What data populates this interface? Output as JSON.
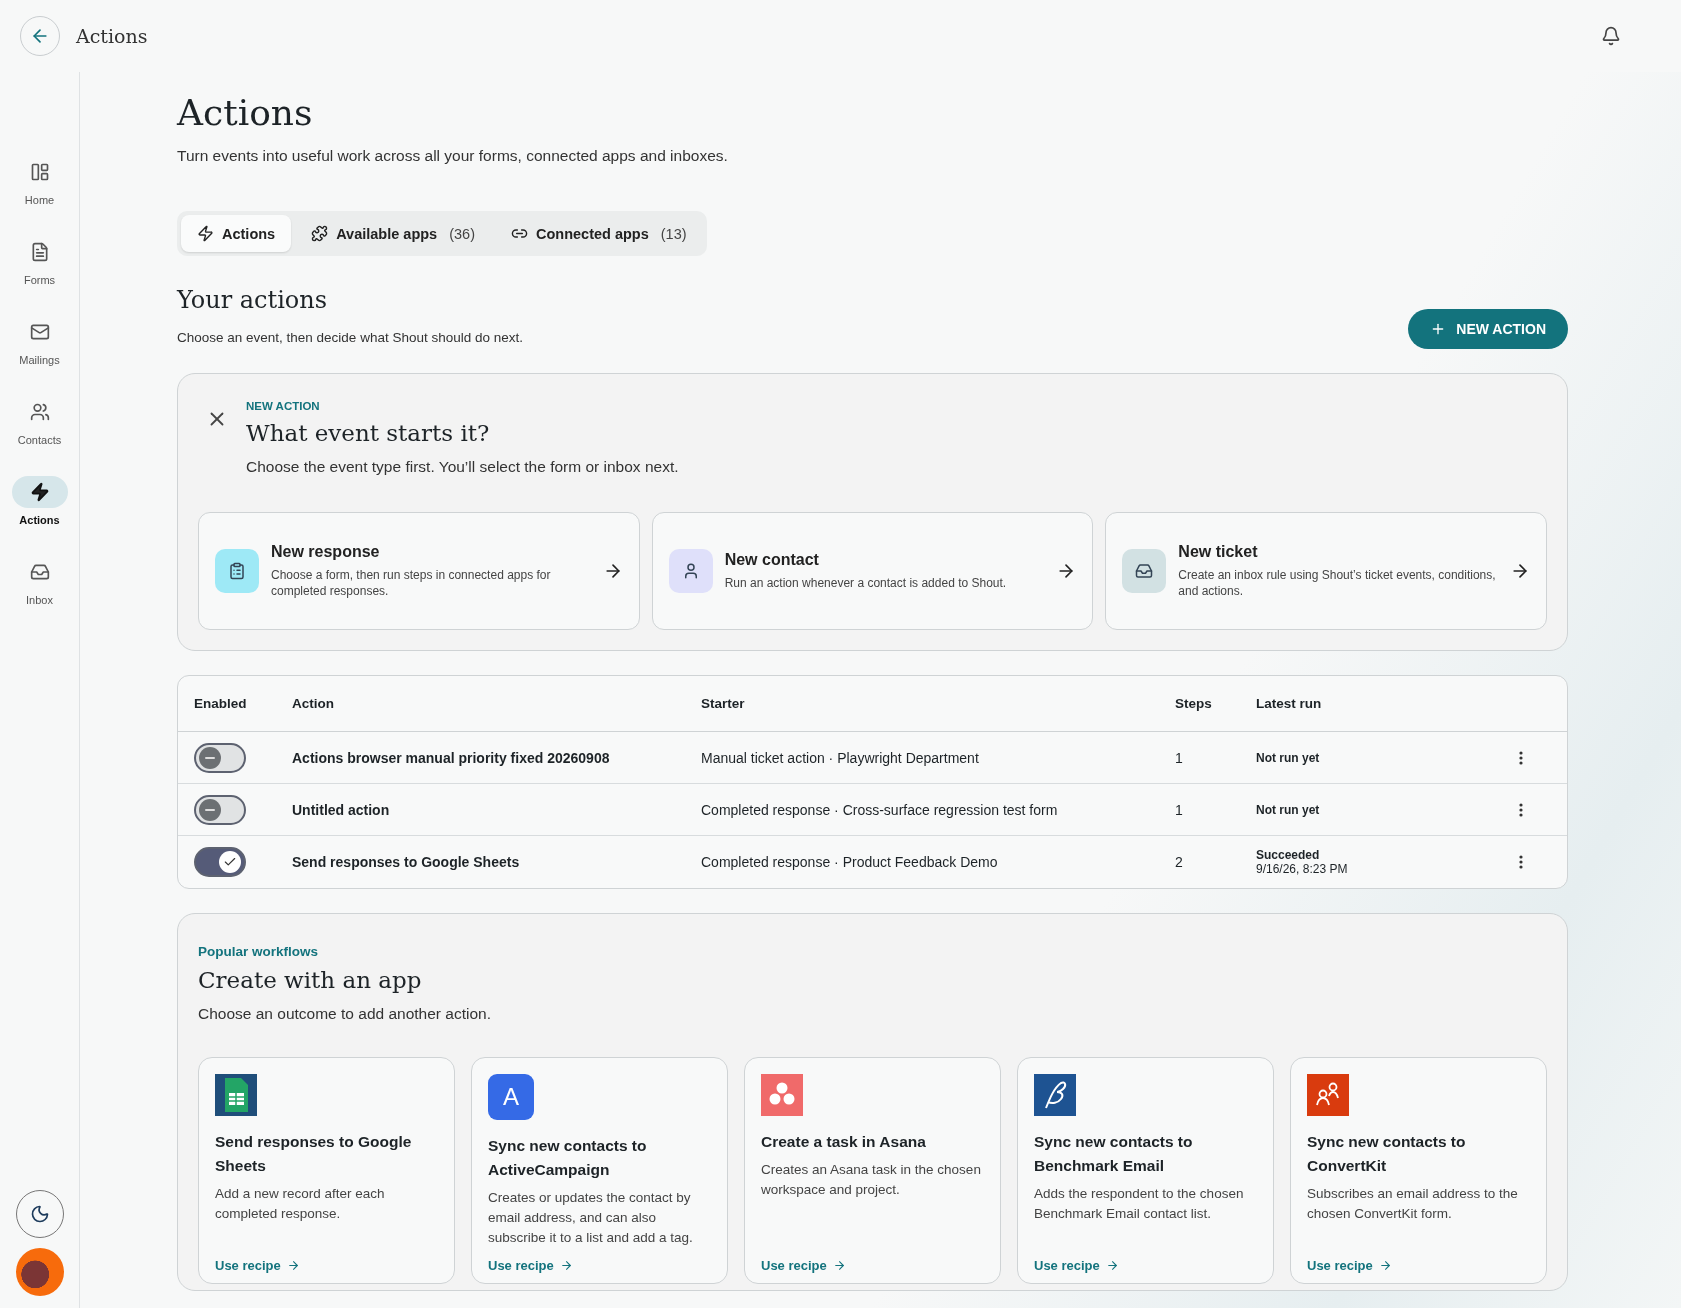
{
  "header": {
    "title": "Actions"
  },
  "nav": [
    {
      "label": "Home",
      "kind": "home",
      "selected": false
    },
    {
      "label": "Forms",
      "kind": "forms",
      "selected": false
    },
    {
      "label": "Mailings",
      "kind": "mail",
      "selected": false
    },
    {
      "label": "Contacts",
      "kind": "contacts",
      "selected": false
    },
    {
      "label": "Actions",
      "kind": "actions",
      "selected": true
    },
    {
      "label": "Inbox",
      "kind": "inbox",
      "selected": false
    }
  ],
  "page": {
    "title": "Actions",
    "subtitle": "Turn events into useful work across all your forms, connected apps and inboxes."
  },
  "tabs": [
    {
      "label": "Actions",
      "kind": "actions",
      "selected": true
    },
    {
      "label": "Available apps",
      "count": "(36)",
      "kind": "apps",
      "selected": false
    },
    {
      "label": "Connected apps",
      "count": "(13)",
      "kind": "link",
      "selected": false
    }
  ],
  "section": {
    "title": "Your actions",
    "subtitle": "Choose an event, then decide what Shout should do next.",
    "button": "NEW ACTION"
  },
  "new_action": {
    "eyebrow": "NEW ACTION",
    "title": "What event starts it?",
    "subtitle": "Choose the event type first. You’ll select the form or inbox next.",
    "options": [
      {
        "kind": "response",
        "title": "New response",
        "description": "Choose a form, then run steps in connected apps for completed responses."
      },
      {
        "kind": "contact",
        "title": "New contact",
        "description": "Run an action whenever a contact is added to Shout."
      },
      {
        "kind": "ticket",
        "title": "New ticket",
        "description": "Create an inbox rule using Shout’s ticket events, conditions, and actions."
      }
    ]
  },
  "table": {
    "columns": [
      "Enabled",
      "Action",
      "Starter",
      "Steps",
      "Latest run"
    ],
    "rows": [
      {
        "enabled": false,
        "action": "Actions browser manual priority fixed 20260908",
        "starter": "Manual ticket action · Playwright Department",
        "steps": "1",
        "latest_run": "Not run yet"
      },
      {
        "enabled": false,
        "action": "Untitled action",
        "starter": "Completed response · Cross-surface regression test form",
        "steps": "1",
        "latest_run": "Not run yet"
      },
      {
        "enabled": true,
        "action": "Send responses to Google Sheets",
        "starter": "Completed response · Product Feedback Demo",
        "steps": "2",
        "latest_run": "Succeeded",
        "latest_run_time": "9/16/26, 8:23 PM"
      }
    ]
  },
  "workflows": {
    "eyebrow": "Popular workflows",
    "title": "Create with an app",
    "subtitle": "Choose an outcome to add another action.",
    "cards": [
      {
        "kind": "sheets",
        "title": "Send responses to Google Sheets",
        "description": "Add a new record after each completed response.",
        "link": "Use recipe"
      },
      {
        "kind": "letter",
        "logo_text": "A",
        "title": "Sync new contacts to ActiveCampaign",
        "description": "Creates or updates the contact by email address, and can also subscribe it to a list and add a tag.",
        "link": "Use recipe"
      },
      {
        "kind": "asana",
        "title": "Create a task in Asana",
        "description": "Creates an Asana task in the chosen workspace and project.",
        "link": "Use recipe"
      },
      {
        "kind": "benchmark",
        "title": "Sync new contacts to Benchmark Email",
        "description": "Adds the respondent to the chosen Benchmark Email contact list.",
        "link": "Use recipe"
      },
      {
        "kind": "convertkit",
        "title": "Sync new contacts to ConvertKit",
        "description": "Subscribes an email address to the chosen ConvertKit form.",
        "link": "Use recipe"
      }
    ]
  }
}
